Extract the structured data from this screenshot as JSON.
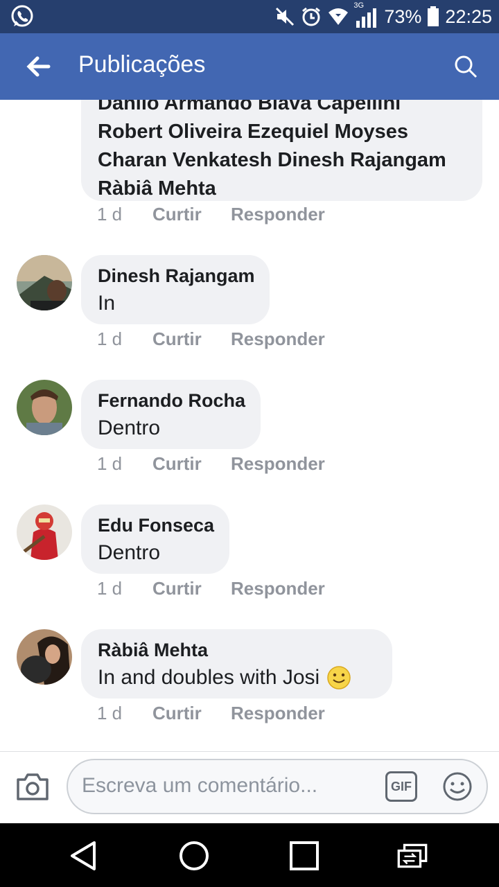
{
  "status": {
    "network": "3G",
    "battery": "73%",
    "time": "22:25"
  },
  "header": {
    "title": "Publicações"
  },
  "partial_comment": {
    "lines": [
      "Danilo Armando Biava Capellini",
      "Robert Oliveira Ezequiel Moyses",
      "Charan Venkatesh Dinesh Rajangam",
      "Ràbiâ Mehta"
    ],
    "meta": {
      "time": "1 d",
      "like": "Curtir",
      "reply": "Responder"
    }
  },
  "comments": [
    {
      "author": "Dinesh Rajangam",
      "text": "In",
      "time": "1 d",
      "like": "Curtir",
      "reply": "Responder"
    },
    {
      "author": "Fernando Rocha",
      "text": "Dentro",
      "time": "1 d",
      "like": "Curtir",
      "reply": "Responder"
    },
    {
      "author": "Edu Fonseca",
      "text": "Dentro",
      "time": "1 d",
      "like": "Curtir",
      "reply": "Responder"
    },
    {
      "author": "Ràbiâ Mehta",
      "text": "In and doubles with Josi",
      "time": "1 d",
      "like": "Curtir",
      "reply": "Responder"
    }
  ],
  "composer": {
    "placeholder": "Escreva um comentário...",
    "gif_label": "GIF"
  },
  "icons": {
    "status": [
      "whatsapp-icon",
      "mute-icon",
      "alarm-icon",
      "wifi-icon",
      "signal-icon",
      "battery-icon"
    ],
    "header": [
      "back-arrow-icon",
      "search-icon"
    ],
    "composer": [
      "camera-icon",
      "gif-icon",
      "emoji-icon"
    ],
    "nav": [
      "back-triangle-icon",
      "home-circle-icon",
      "recents-square-icon",
      "switch-apps-icon"
    ]
  },
  "colors": {
    "statusbar": "#263f6e",
    "appbar": "#4267b2",
    "bubble": "#f0f1f4",
    "meta": "#90949c"
  }
}
